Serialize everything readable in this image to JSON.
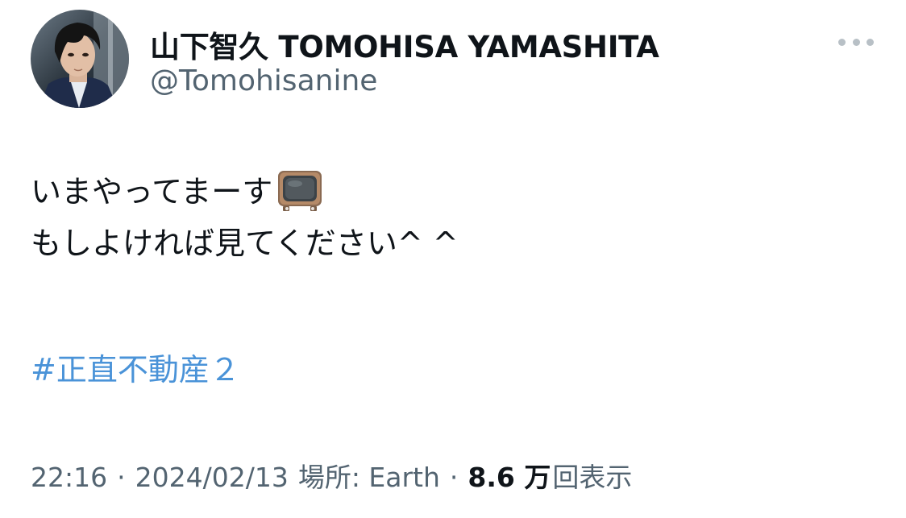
{
  "author": {
    "display_name": "山下智久 TOMOHISA YAMASHITA",
    "handle": "@Tomohisanine"
  },
  "tweet": {
    "line1": "いまやってまーす",
    "line1_emoji": "tv-icon",
    "line2": "もしよければ見てください^ ^",
    "hashtag": "#正直不動産２"
  },
  "meta": {
    "time": "22:16",
    "separator": "·",
    "date": "2024/02/13",
    "location": "場所: Earth",
    "views_count": "8.6 万",
    "views_label": "回表示"
  },
  "colors": {
    "text": "#0f1419",
    "secondary": "#536471",
    "link": "#4a93d8"
  }
}
